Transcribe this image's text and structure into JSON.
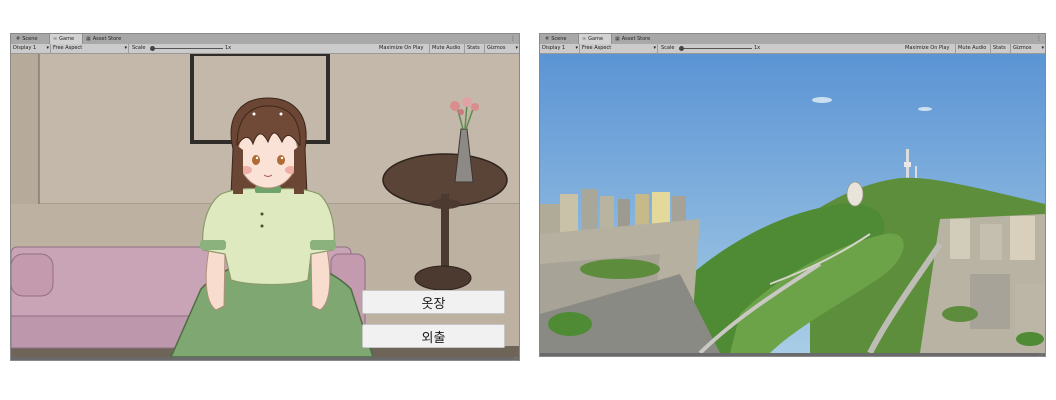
{
  "left_window": {
    "tabs": [
      {
        "label": "Scene",
        "icon": "grid-icon"
      },
      {
        "label": "Game",
        "icon": "gamepad-icon",
        "active": true
      },
      {
        "label": "Asset Store",
        "icon": "store-icon"
      }
    ],
    "toolbar": {
      "display": "Display 1",
      "aspect": "Free Aspect",
      "scale_label": "Scale",
      "scale_value": "1x",
      "maximize": "Maximize On Play",
      "mute": "Mute Audio",
      "stats": "Stats",
      "gizmos": "Gizmos"
    },
    "game": {
      "buttons": [
        "옷장",
        "외출"
      ]
    }
  },
  "right_window": {
    "tabs": [
      {
        "label": "Scene",
        "icon": "grid-icon"
      },
      {
        "label": "Game",
        "icon": "gamepad-icon",
        "active": true
      },
      {
        "label": "Asset Store",
        "icon": "store-icon"
      }
    ],
    "toolbar": {
      "display": "Display 1",
      "aspect": "Free Aspect",
      "scale_label": "Scale",
      "scale_value": "1x",
      "maximize": "Maximize On Play",
      "mute": "Mute Audio",
      "stats": "Stats",
      "gizmos": "Gizmos"
    }
  },
  "colors": {
    "wall": "#c3b8a9",
    "sofa": "#c9a4b8",
    "dress": "#7fa872",
    "blouse": "#dfe9bf",
    "sky": "#6fa6dc",
    "forest": "#5f8f3a"
  }
}
